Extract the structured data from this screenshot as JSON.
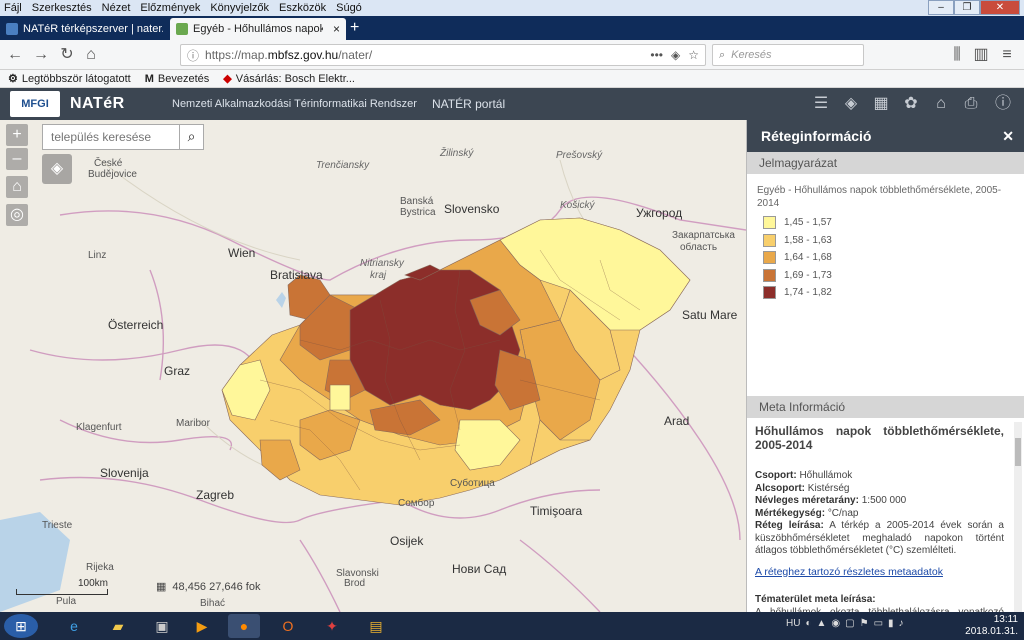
{
  "browser": {
    "menu": [
      "Fájl",
      "Szerkesztés",
      "Nézet",
      "Előzmények",
      "Könyvjelzők",
      "Eszközök",
      "Súgó"
    ],
    "tabs": [
      {
        "label": "NATéR térképszerver | nater.mbfsz.gov.hu"
      },
      {
        "label": "Egyéb - Hőhullámos napok többlethőmérséklete"
      }
    ],
    "url_prefix": "https://map.",
    "url_domain": "mbfsz.gov.hu",
    "url_path": "/nater/",
    "search_placeholder": "Keresés",
    "bookmarks": [
      "Legtöbbször látogatott",
      "Bevezetés",
      "Vásárlás: Bosch Elektr..."
    ]
  },
  "app": {
    "logo": "MFGI",
    "brand": "NATéR",
    "subtitle": "Nemzeti Alkalmazkodási Térinformatikai Rendszer",
    "portal": "NATÉR portál"
  },
  "map": {
    "town_search_placeholder": "település keresése",
    "scale_label": "100km",
    "coords": "48,456  27,646 fok",
    "labels": {
      "ceske": "České",
      "budejovice": "Budějovice",
      "wien": "Wien",
      "bratislava": "Bratislava",
      "osterreich": "Österreich",
      "graz": "Graz",
      "klagenfurt": "Klagenfurt",
      "maribor": "Maribor",
      "slovenija": "Slovenija",
      "zagreb": "Zagreb",
      "trieste": "Trieste",
      "pula": "Pula",
      "slovensko": "Slovensko",
      "banska": "Banská",
      "bystrica": "Bystrica",
      "uzhorod": "Ужгород",
      "zakarpatska": "Закарпатська",
      "oblast": "область",
      "satu": "Satu Mare",
      "timisoara": "Timişoara",
      "subotica": "Суботица",
      "osijek": "Osijek",
      "novisad": "Нови Сад",
      "nitriansky": "Nitriansky",
      "kraj": "kraj",
      "zilinsky": "Žilinský",
      "presovsky": "Prešovský",
      "kosicky": "Košický",
      "slavonski": "Slavonski",
      "brod": "Brod",
      "bihac": "Bihać",
      "linz": "Linz",
      "rijeka": "Rijeka",
      "sombor": "Сомбор",
      "arad": "Arad",
      "trencin": "Trenčiansky"
    }
  },
  "panel": {
    "title": "Réteginformáció",
    "legend_header": "Jelmagyarázat",
    "legend_title": "Egyéb - Hőhullámos napok többlethőmérséklete, 2005-2014",
    "legend": [
      {
        "label": "1,45 - 1,57",
        "color": "#fff79a"
      },
      {
        "label": "1,58 - 1,63",
        "color": "#f8cf6c"
      },
      {
        "label": "1,64 - 1,68",
        "color": "#e9a84a"
      },
      {
        "label": "1,69 - 1,73",
        "color": "#c97436"
      },
      {
        "label": "1,74 - 1,82",
        "color": "#8c2e2a"
      }
    ],
    "meta_header": "Meta Információ",
    "meta_title": "Hőhullámos napok többlethőmérséklete, 2005-2014",
    "meta": {
      "csoport_label": "Csoport:",
      "csoport": "Hőhullámok",
      "alcsoport_label": "Alcsoport:",
      "alcsoport": "Kistérség",
      "meretarany_label": "Névleges méretarány:",
      "meretarany": "1:500 000",
      "mertekegyseg_label": "Mértékegység:",
      "mertekegyseg": "°C/nap",
      "leiras_label": "Réteg leírása:",
      "leiras": "A térkép a 2005-2014 évek során a küszöbhőmérsékletet meghaladó napokon történt átlagos többlethőmérsékletet (°C) szemlélteti.",
      "link": "A réteghez tartozó részletes metaadatok",
      "tema_label": "Tématerület meta leírása:",
      "tema": "A hőhullámok okozta többlethalálozásra vonatkozó vizsgálatok eredményeit a NATéR hőhullámok"
    }
  },
  "taskbar": {
    "lang": "HU",
    "time": "13:11",
    "date": "2018.01.31."
  }
}
